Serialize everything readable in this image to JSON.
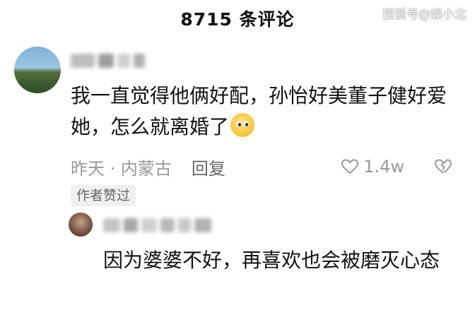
{
  "header": {
    "title": "8715 条评论"
  },
  "watermark": "搜狐号@娱小北",
  "comment": {
    "text": "我一直觉得他俩好配，孙怡好美董子健好爱她，怎么就离婚了",
    "emoji_icon": "pleading-face-icon",
    "time_location": "昨天 · 内蒙古",
    "reply_label": "回复",
    "likes": "1.4w",
    "author_liked_tag": "作者赞过"
  },
  "reply": {
    "text": "因为婆婆不好，再喜欢也会被磨灭心态"
  }
}
